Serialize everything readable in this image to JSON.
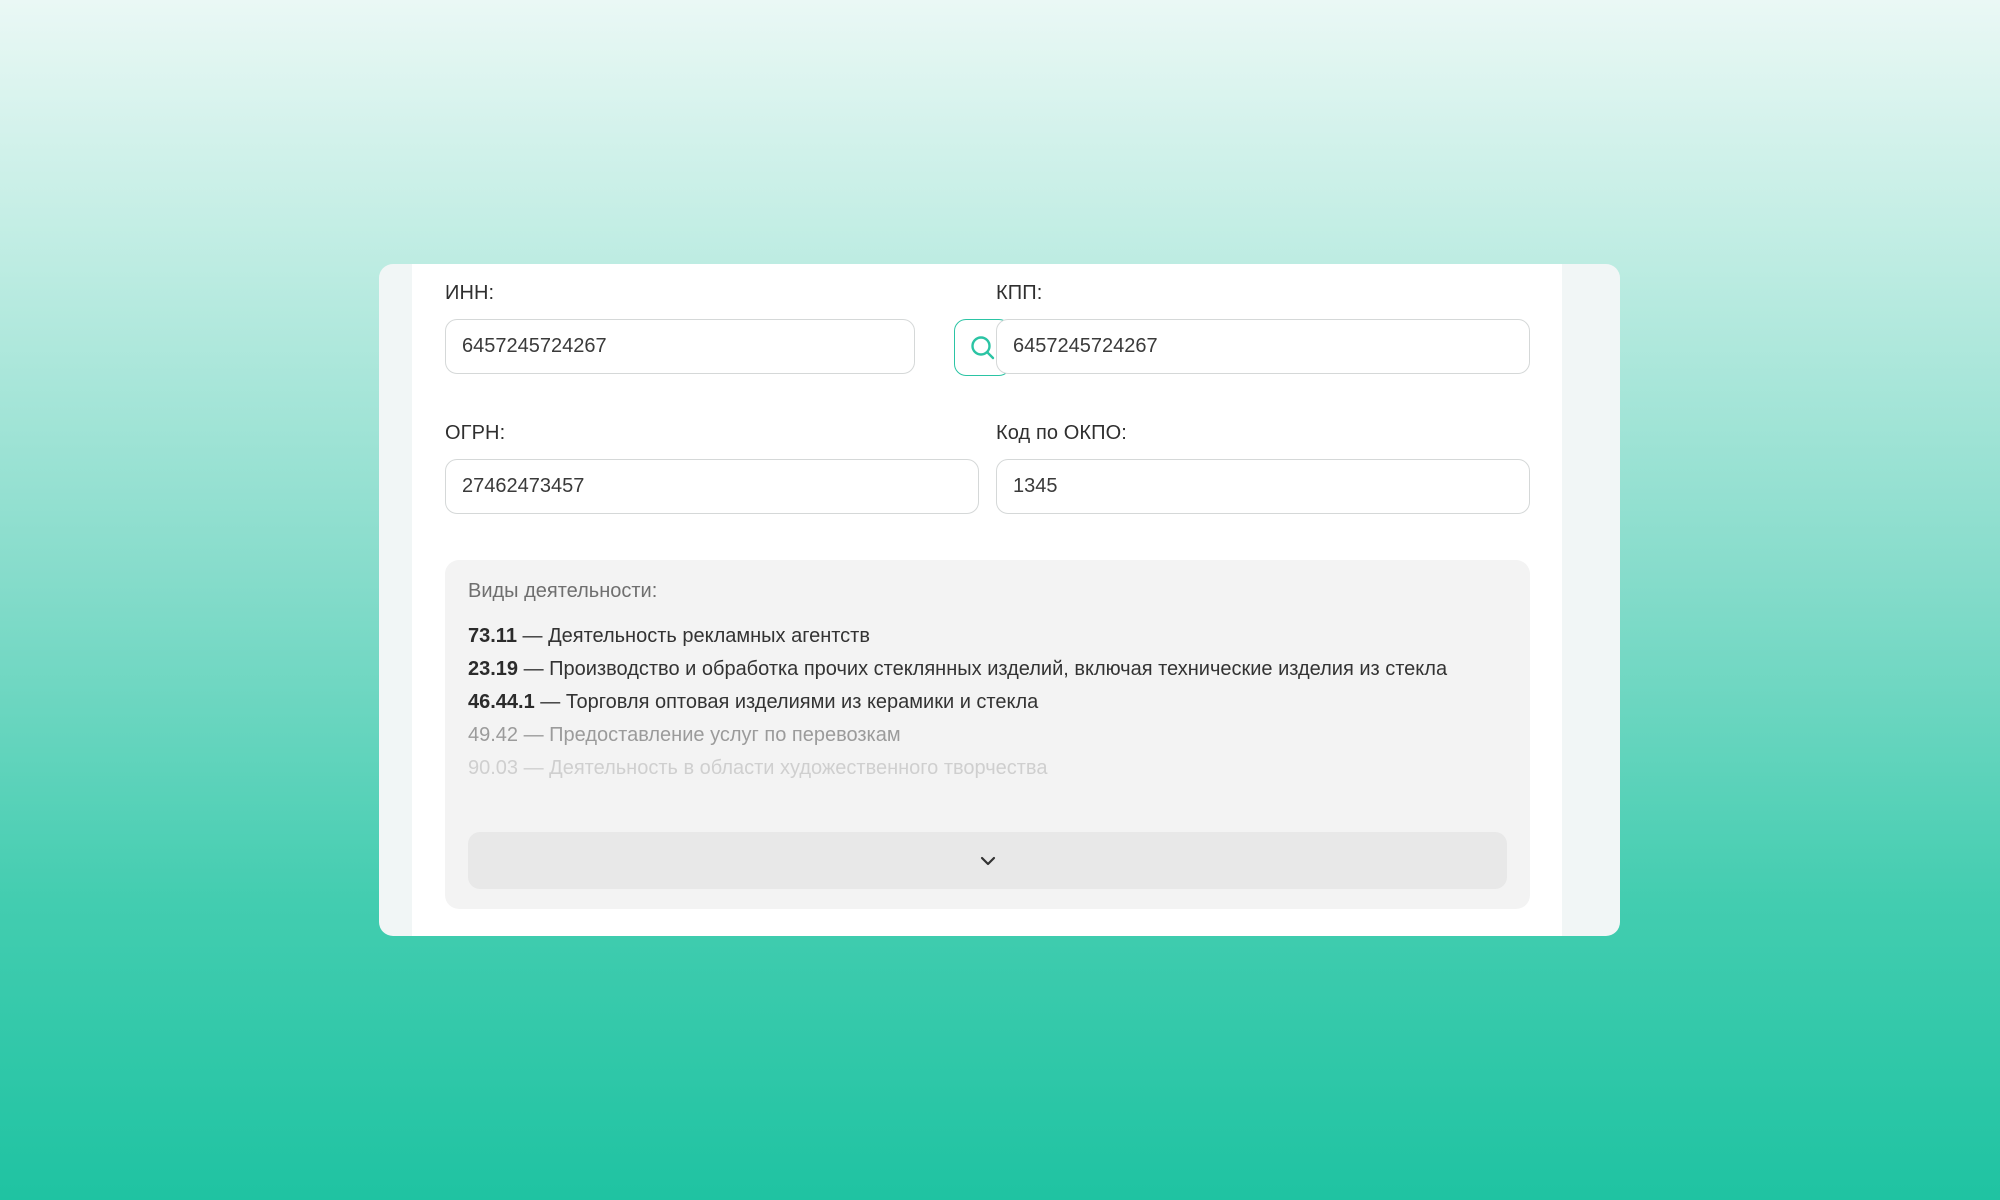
{
  "form": {
    "inn": {
      "label": "ИНН:",
      "value": "6457245724267"
    },
    "kpp": {
      "label": "КПП:",
      "value": "6457245724267"
    },
    "ogrn": {
      "label": "ОГРН:",
      "value": "27462473457"
    },
    "okpo": {
      "label": "Код по ОКПО:",
      "value": "1345"
    },
    "search_icon": "search-icon"
  },
  "activities": {
    "title": "Виды деятельности:",
    "items": [
      {
        "code": "73.11",
        "text": " — Деятельность рекламных агентств"
      },
      {
        "code": "23.19",
        "text": " — Производство и обработка прочих стеклянных изделий, включая технические изделия из стекла"
      },
      {
        "code": "46.44.1",
        "text": " — Торговля оптовая изделиями из керамики и стекла"
      },
      {
        "code": "49.42",
        "text": " — Предоставление услуг по перевозкам"
      },
      {
        "code": "90.03",
        "text": " — Деятельность в области художественного творчества"
      }
    ],
    "expand_icon": "chevron-down-icon"
  },
  "colors": {
    "accent": "#2bc4a4",
    "background_top": "#eaf8f5",
    "background_bottom": "#1fc3a2"
  }
}
